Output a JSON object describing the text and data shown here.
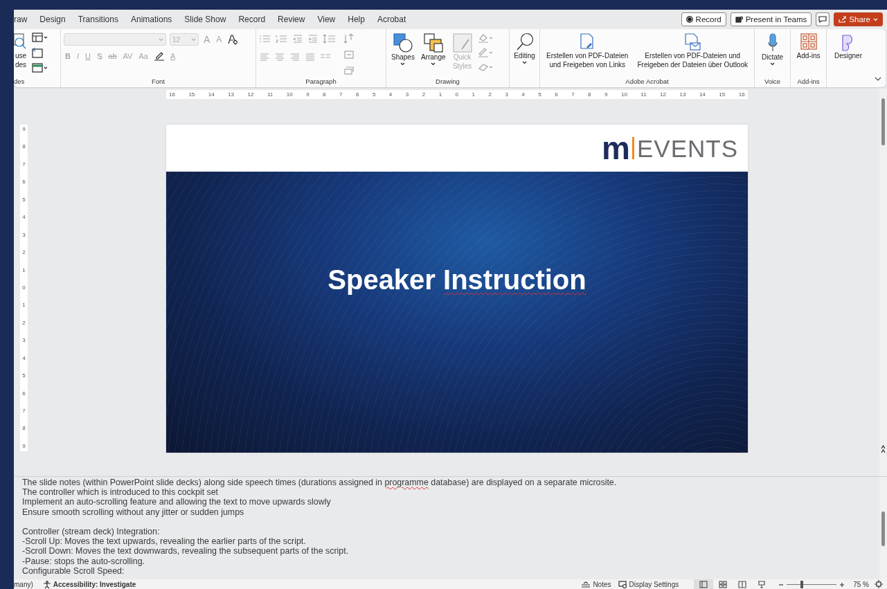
{
  "tabs": [
    "raw",
    "Design",
    "Transitions",
    "Animations",
    "Slide Show",
    "Record",
    "Review",
    "View",
    "Help",
    "Acrobat"
  ],
  "header_buttons": {
    "record": "Record",
    "present": "Present in Teams",
    "share": "Share"
  },
  "ribbon": {
    "slides_group": {
      "button": "use\ndes",
      "label": "des"
    },
    "font_group": {
      "label": "Font",
      "disabled": true,
      "font_size": "12",
      "size_buttons": [
        "A",
        "A"
      ],
      "format_buttons": [
        "B",
        "I",
        "U",
        "S",
        "ab",
        "AV",
        "Aa"
      ],
      "color_button": "A"
    },
    "paragraph_group": {
      "label": "Paragraph",
      "disabled": true
    },
    "drawing_group": {
      "label": "Drawing",
      "buttons": [
        {
          "kind": "shapes",
          "label": "Shapes",
          "disabled": false
        },
        {
          "kind": "arrange",
          "label": "Arrange",
          "disabled": false
        },
        {
          "kind": "styles",
          "label": "Quick\nStyles",
          "disabled": true
        }
      ]
    },
    "editing": {
      "label": "Editing"
    },
    "acrobat_group": {
      "label": "Adobe Acrobat",
      "buttons": [
        {
          "kind": "link",
          "label": "Erstellen von PDF-Dateien\nund Freigeben von Links"
        },
        {
          "kind": "mail",
          "label": "Erstellen von PDF-Dateien und\nFreigeben der Dateien über Outlook"
        }
      ]
    },
    "voice_group": {
      "label": "Voice",
      "button": "Dictate"
    },
    "addins_group": {
      "label": "Add-ins",
      "button": "Add-ins"
    },
    "designer": {
      "label": "Designer"
    }
  },
  "horizontal_ruler": [
    "16",
    "15",
    "14",
    "13",
    "12",
    "11",
    "10",
    "9",
    "8",
    "7",
    "6",
    "5",
    "4",
    "3",
    "2",
    "1",
    "0",
    "1",
    "2",
    "3",
    "4",
    "5",
    "6",
    "7",
    "8",
    "9",
    "10",
    "11",
    "12",
    "13",
    "14",
    "15",
    "16"
  ],
  "vertical_ruler": [
    "9",
    "8",
    "7",
    "6",
    "5",
    "4",
    "3",
    "2",
    "1",
    "0",
    "1",
    "2",
    "3",
    "4",
    "5",
    "6",
    "7",
    "8",
    "9"
  ],
  "slide": {
    "logo": {
      "mark": "m",
      "name": "EVENTS"
    },
    "title": [
      {
        "text": "Speaker ",
        "misspelled": false
      },
      {
        "text": "Instruction",
        "misspelled": true
      }
    ]
  },
  "notes": [
    [
      [
        {
          "text": "The slide notes (within PowerPoint slide decks) along side speech times (durations assigned in ",
          "misspelled": false
        },
        {
          "text": "programme",
          "misspelled": true
        },
        {
          "text": " database) are displayed on a separate microsite.",
          "misspelled": false
        }
      ],
      [
        {
          "text": "The controller which is introduced to this cockpit set",
          "misspelled": false
        }
      ],
      [
        {
          "text": "Implement an auto-scrolling feature and allowing the text to move upwards slowly",
          "misspelled": false
        }
      ],
      [
        {
          "text": "Ensure smooth scrolling without any jitter or sudden jumps",
          "misspelled": false
        }
      ]
    ],
    [
      [
        {
          "text": "Controller (stream deck) Integration:",
          "misspelled": false
        }
      ],
      [
        {
          "text": "-Scroll Up: Moves the text upwards, revealing the earlier parts of the script.",
          "misspelled": false
        }
      ],
      [
        {
          "text": "-Scroll Down: Moves the text downwards, revealing the subsequent parts of the script.",
          "misspelled": false
        }
      ],
      [
        {
          "text": "-Pause: stops the auto-scrolling.",
          "misspelled": false
        }
      ],
      [
        {
          "text": "Configurable Scroll Speed:",
          "misspelled": false
        }
      ]
    ]
  ],
  "status_bar": {
    "language": "many)",
    "accessibility": "Accessibility: Investigate",
    "notes": "Notes",
    "display_settings": "Display Settings",
    "views": [
      {
        "kind": "normal",
        "selected": true
      },
      {
        "kind": "sorter",
        "selected": false
      },
      {
        "kind": "reading",
        "selected": false
      },
      {
        "kind": "slideshow",
        "selected": false
      }
    ],
    "zoom": {
      "level": 0.3,
      "reading": "75 %"
    }
  }
}
